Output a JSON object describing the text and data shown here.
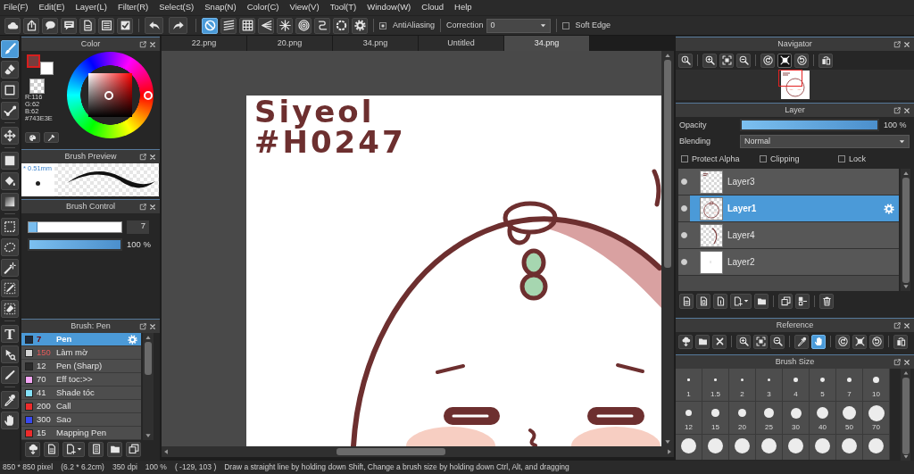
{
  "menu_bar": [
    "File(F)",
    "Edit(E)",
    "Layer(L)",
    "Filter(R)",
    "Select(S)",
    "Snap(N)",
    "Color(C)",
    "View(V)",
    "Tool(T)",
    "Window(W)",
    "Cloud",
    "Help"
  ],
  "toolbar": {
    "file_buttons": [
      {
        "kind": "cloud"
      },
      {
        "kind": "export"
      },
      {
        "kind": "bubble"
      },
      {
        "kind": "comment"
      },
      {
        "kind": "page"
      },
      {
        "kind": "list"
      },
      {
        "kind": "checklist"
      }
    ],
    "history_buttons": [
      {
        "kind": "undo"
      },
      {
        "kind": "redo"
      }
    ],
    "snap_buttons": [
      {
        "kind": "snap-off",
        "selected": true
      },
      {
        "kind": "parallel",
        "selected": false
      },
      {
        "kind": "grid",
        "selected": false
      },
      {
        "kind": "vanishing",
        "selected": false
      },
      {
        "kind": "radial",
        "selected": false
      },
      {
        "kind": "concentric",
        "selected": false
      },
      {
        "kind": "curve",
        "selected": false
      },
      {
        "kind": "circle",
        "selected": false
      },
      {
        "kind": "settings",
        "selected": false
      }
    ],
    "antialiasing": {
      "label": "AntiAliasing",
      "checked": true
    },
    "correction": {
      "label": "Correction",
      "value": "0"
    },
    "soft_edge": {
      "label": "Soft Edge",
      "checked": false
    }
  },
  "tool_groups": [
    [
      {
        "kind": "brush",
        "selected": true
      },
      {
        "kind": "eraser",
        "selected": false
      },
      {
        "kind": "dot",
        "selected": false
      },
      {
        "kind": "polyline",
        "selected": false
      }
    ],
    [
      {
        "kind": "move",
        "selected": false
      }
    ],
    [
      {
        "kind": "fill",
        "selected": false
      },
      {
        "kind": "bucket",
        "selected": false
      },
      {
        "kind": "gradient",
        "selected": false
      }
    ],
    [
      {
        "kind": "select-rect",
        "selected": false
      },
      {
        "kind": "lasso",
        "selected": false
      },
      {
        "kind": "wand",
        "selected": false
      },
      {
        "kind": "select-pen",
        "selected": false
      },
      {
        "kind": "select-eraser",
        "selected": false
      }
    ],
    [
      {
        "kind": "text",
        "label": "T",
        "selected": false
      },
      {
        "kind": "operation",
        "selected": false
      },
      {
        "kind": "divide",
        "selected": false
      }
    ],
    [
      {
        "kind": "eyedropper",
        "selected": false
      },
      {
        "kind": "hand",
        "selected": false
      }
    ]
  ],
  "color_panel": {
    "title": "Color",
    "swatches": [
      {
        "kind": "secondary",
        "color": "#ffffff"
      },
      {
        "kind": "primary",
        "color": "#743e3e"
      },
      {
        "kind": "transparent"
      }
    ],
    "values": [
      "R:116",
      "G:62",
      "B:62",
      "#743E3E"
    ],
    "buttons": [
      {
        "kind": "palette"
      },
      {
        "kind": "picker"
      }
    ]
  },
  "brush_preview": {
    "title": "Brush Preview",
    "size": "* 0.51mm"
  },
  "brush_control": {
    "title": "Brush Control",
    "size": {
      "level": 0.1,
      "value": "7"
    },
    "opacity": {
      "level": 1,
      "value": "100 %"
    }
  },
  "brush_panel": {
    "title": "Brush: Pen",
    "brushes": [
      {
        "color": "#1d2b3d",
        "size": "7",
        "name": "Pen",
        "flagged": true,
        "selected": true
      },
      {
        "color": "#d2d2d2",
        "size": "150",
        "name": "Làm mờ",
        "flagged": true,
        "selected": false
      },
      {
        "color": "#2a2a2a",
        "size": "12",
        "name": "Pen (Sharp)",
        "flagged": false,
        "selected": false
      },
      {
        "color": "#f4a6f4",
        "size": "70",
        "name": "Eff toc:>>",
        "flagged": false,
        "selected": false
      },
      {
        "color": "#84e2fa",
        "size": "41",
        "name": "Shade tóc",
        "flagged": false,
        "selected": false
      },
      {
        "color": "#ee2b2b",
        "size": "200",
        "name": "Call",
        "flagged": false,
        "selected": false
      },
      {
        "color": "#3748f0",
        "size": "300",
        "name": "Sao",
        "flagged": false,
        "selected": false
      },
      {
        "color": "#ee2b2b",
        "size": "15",
        "name": "Mapping Pen",
        "flagged": false,
        "selected": false
      }
    ],
    "buttons": [
      {
        "kind": "cloud-down"
      },
      {
        "kind": "page"
      },
      {
        "kind": "page-add"
      },
      {
        "kind": "script"
      },
      {
        "kind": "folder"
      },
      {
        "kind": "copy"
      }
    ]
  },
  "canvas": {
    "tabs": [
      {
        "label": "22.png",
        "selected": false
      },
      {
        "label": "20.png",
        "selected": false
      },
      {
        "label": "34.png",
        "selected": false
      },
      {
        "label": "Untitled",
        "selected": false
      },
      {
        "label": "34.png",
        "selected": true
      }
    ],
    "handwriting": [
      "Siyeol",
      "#H0247"
    ]
  },
  "navigator": {
    "title": "Navigator",
    "button_groups": [
      [
        {
          "kind": "zoom-actual",
          "selected": false
        }
      ],
      [
        {
          "kind": "zoom-in",
          "selected": false
        },
        {
          "kind": "fit",
          "selected": false
        },
        {
          "kind": "zoom-out",
          "selected": false
        }
      ],
      [
        {
          "kind": "rotate-left",
          "selected": false
        },
        {
          "kind": "center",
          "selected": true
        },
        {
          "kind": "rotate-right",
          "selected": false
        }
      ],
      [
        {
          "kind": "flip",
          "selected": false
        }
      ]
    ]
  },
  "layer_panel": {
    "title": "Layer",
    "opacity": {
      "label": "Opacity",
      "level": 1,
      "value": "100 %"
    },
    "blending": {
      "label": "Blending",
      "value": "Normal"
    },
    "options": [
      {
        "label": "Protect Alpha",
        "checked": false
      },
      {
        "label": "Clipping",
        "checked": false
      },
      {
        "label": "Lock",
        "checked": false
      }
    ],
    "layers": [
      {
        "name": "Layer3",
        "kind": "sketch",
        "visible": true,
        "selected": false
      },
      {
        "name": "Layer1",
        "kind": "character",
        "visible": true,
        "selected": true
      },
      {
        "name": "Layer4",
        "kind": "arc",
        "visible": true,
        "selected": false
      },
      {
        "name": "Layer2",
        "kind": "paper",
        "visible": true,
        "selected": false
      }
    ],
    "button_groups": [
      [
        {
          "kind": "page"
        },
        {
          "kind": "page-box"
        },
        {
          "kind": "page-mark"
        },
        {
          "kind": "page-add"
        },
        {
          "kind": "folder"
        }
      ],
      [
        {
          "kind": "copy"
        },
        {
          "kind": "merge"
        }
      ],
      [
        {
          "kind": "trash"
        }
      ]
    ]
  },
  "reference": {
    "title": "Reference",
    "button_groups": [
      [
        {
          "kind": "cloud-down",
          "selected": false
        },
        {
          "kind": "folder",
          "selected": false
        },
        {
          "kind": "close",
          "selected": false
        }
      ],
      [
        {
          "kind": "zoom-in",
          "selected": false
        },
        {
          "kind": "fit",
          "selected": false
        },
        {
          "kind": "zoom-out",
          "selected": false
        }
      ],
      [
        {
          "kind": "eyedropper",
          "selected": false
        },
        {
          "kind": "hand",
          "selected": true
        }
      ],
      [
        {
          "kind": "rotate-left",
          "selected": false
        },
        {
          "kind": "center",
          "selected": false
        },
        {
          "kind": "rotate-right",
          "selected": false
        }
      ],
      [
        {
          "kind": "flip",
          "selected": false
        }
      ]
    ]
  },
  "brush_size": {
    "title": "Brush Size",
    "sizes": [
      "1",
      "1.5",
      "2",
      "3",
      "4",
      "5",
      "7",
      "10",
      "12",
      "15",
      "20",
      "25",
      "30",
      "40",
      "50",
      "70"
    ]
  },
  "status_bar": [
    "850 * 850 pixel",
    "(6.2 * 6.2cm)",
    "350 dpi",
    "100 %",
    "( -129, 103 )",
    "Draw a straight line by holding down Shift, Change a brush size by holding down Ctrl, Alt, and dragging"
  ]
}
